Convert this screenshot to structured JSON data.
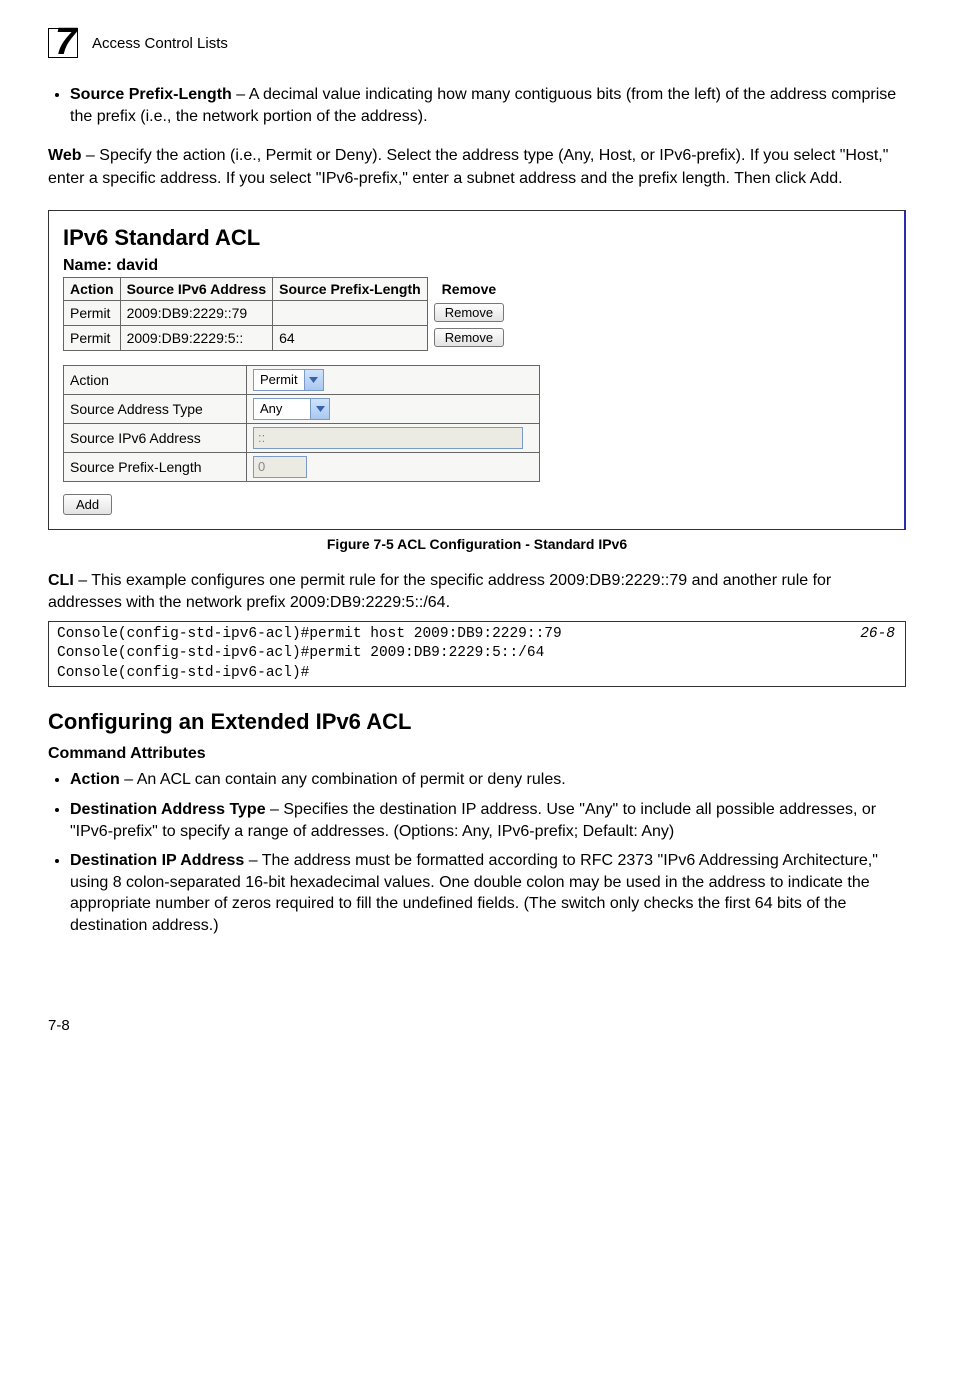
{
  "chapter": {
    "number": "7",
    "title": "Access Control Lists"
  },
  "top_bullets": [
    {
      "label": "Source Prefix-Length",
      "text": " – A decimal value indicating how many contiguous bits (from the left) of the address comprise the prefix (i.e., the network portion of the address)."
    }
  ],
  "web_para_lead": "Web",
  "web_para_text": " – Specify the action (i.e., Permit or Deny). Select the address type (Any, Host, or IPv6-prefix). If you select \"Host,\" enter a specific address. If you select \"IPv6-prefix,\" enter a subnet address and the prefix length. Then click Add.",
  "screenshot": {
    "heading": "IPv6 Standard ACL",
    "name_label": "Name: david",
    "columns": {
      "c1": "Action",
      "c2": "Source IPv6 Address",
      "c3": "Source Prefix-Length",
      "c4": "Remove"
    },
    "rows": [
      {
        "action": "Permit",
        "addr": "2009:DB9:2229::79",
        "prefix": "",
        "btn": "Remove"
      },
      {
        "action": "Permit",
        "addr": "2009:DB9:2229:5::",
        "prefix": "64",
        "btn": "Remove"
      }
    ],
    "form": {
      "action_label": "Action",
      "action_value": "Permit",
      "sat_label": "Source Address Type",
      "sat_value": "Any",
      "sip_label": "Source IPv6 Address",
      "sip_value": "::",
      "spl_label": "Source Prefix-Length",
      "spl_value": "0"
    },
    "add_button": "Add"
  },
  "figure_caption": "Figure 7-5   ACL Configuration - Standard IPv6",
  "cli_para_lead": "CLI",
  "cli_para_text": " – This example configures one permit rule for the specific address 2009:DB9:2229::79 and another rule for addresses with the network prefix 2009:DB9:2229:5::/64.",
  "code": {
    "line1": "Console(config-std-ipv6-acl)#permit host 2009:DB9:2229::79",
    "ref": "26-8",
    "line2": "Console(config-std-ipv6-acl)#permit 2009:DB9:2229:5::/64",
    "line3": "Console(config-std-ipv6-acl)#"
  },
  "section_heading": "Configuring an Extended IPv6 ACL",
  "command_attributes_label": "Command Attributes",
  "attr_bullets": [
    {
      "label": "Action",
      "text": " – An ACL can contain any combination of permit or deny rules."
    },
    {
      "label": "Destination Address Type",
      "text": " – Specifies the destination IP address. Use \"Any\" to include all possible addresses, or \"IPv6-prefix\" to specify a range of addresses. (Options: Any, IPv6-prefix; Default: Any)"
    },
    {
      "label": "Destination IP Address",
      "text": " – The address must be formatted according to RFC 2373 \"IPv6 Addressing Architecture,\" using 8 colon-separated 16-bit hexadecimal values. One double colon may be used in the address to indicate the appropriate number of zeros required to fill the undefined fields. (The switch only checks the first 64 bits of the destination address.)"
    }
  ],
  "page_number": "7-8"
}
